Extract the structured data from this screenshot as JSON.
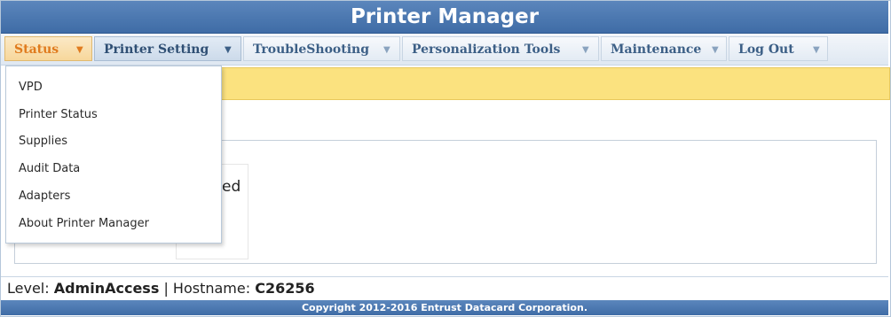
{
  "header": {
    "title": "Printer Manager"
  },
  "menu": [
    {
      "label": "Status",
      "caret": "▼"
    },
    {
      "label": "Printer Setting",
      "caret": "▼"
    },
    {
      "label": "TroubleShooting",
      "caret": "▼"
    },
    {
      "label": "Personalization Tools",
      "caret": "▼"
    },
    {
      "label": "Maintenance",
      "caret": "▼"
    },
    {
      "label": "Log Out",
      "caret": "▼"
    }
  ],
  "dropdown": {
    "items": [
      {
        "label": "VPD"
      },
      {
        "label": "Printer Status"
      },
      {
        "label": "Supplies"
      },
      {
        "label": "Audit Data"
      },
      {
        "label": "Adapters"
      },
      {
        "label": "About Printer Manager"
      }
    ]
  },
  "panel": {
    "partial_text": "ed"
  },
  "status": {
    "level_label": "Level: ",
    "level_value": "AdminAccess",
    "separator": " | ",
    "host_label": "Hostname: ",
    "host_value": "C26256"
  },
  "footer": {
    "copyright": "Copyright 2012-2016 Entrust Datacard Corporation."
  },
  "colors": {
    "header_bg": "#4a77b0",
    "active_menu_text": "#e07b1e",
    "notice_bg": "#fbe27f"
  }
}
